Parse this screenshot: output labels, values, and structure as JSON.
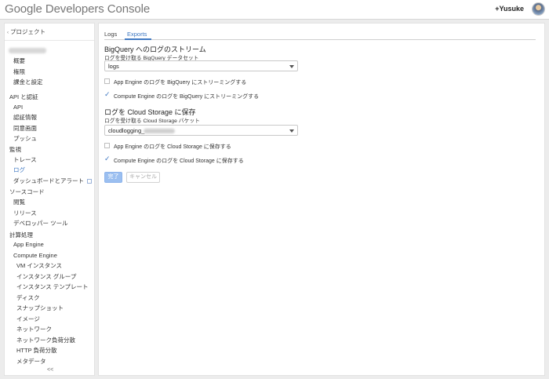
{
  "header": {
    "logo": "Google Developers Console",
    "user": "+Yusuke"
  },
  "sidebar": {
    "back_label": "プロジェクト",
    "project_items": [
      {
        "label": "概要"
      },
      {
        "label": "権限"
      },
      {
        "label": "課金と設定"
      }
    ],
    "sections": [
      {
        "title": "API と認証",
        "items": [
          "API",
          "認証情報",
          "同意画面",
          "プッシュ"
        ]
      },
      {
        "title": "監視",
        "items": [
          "トレース",
          "ログ",
          "ダッシュボードとアラート"
        ]
      },
      {
        "title": "ソースコード",
        "items": [
          "閲覧",
          "リリース",
          "デベロッパー ツール"
        ]
      },
      {
        "title": "計算処理",
        "items": [
          "App Engine",
          "Compute Engine"
        ]
      }
    ],
    "compute_subitems": [
      "VM インスタンス",
      "インスタンス グループ",
      "インスタンス テンプレート",
      "ディスク",
      "スナップショット",
      "イメージ",
      "ネットワーク",
      "ネットワーク負荷分散",
      "HTTP 負荷分散",
      "メタデータ"
    ],
    "active_item": "ログ",
    "collapse_label": "<<"
  },
  "tabs": [
    {
      "label": "Logs",
      "active": false
    },
    {
      "label": "Exports",
      "active": true
    }
  ],
  "bigquery": {
    "title": "BigQuery へのログのストリーム",
    "dataset_label": "ログを受け取る BigQuery データセット",
    "dataset_value": "logs",
    "checkboxes": [
      {
        "label": "App Engine のログを BigQuery にストリーミングする",
        "checked": false
      },
      {
        "label": "Compute Engine のログを BigQuery にストリーミングする",
        "checked": true
      }
    ]
  },
  "storage": {
    "title": "ログを Cloud Storage に保存",
    "bucket_label": "ログを受け取る Cloud Storage バケット",
    "bucket_value": "cloudlogging_",
    "checkboxes": [
      {
        "label": "App Engine のログを Cloud Storage に保存する",
        "checked": false
      },
      {
        "label": "Compute Engine のログを Cloud Storage に保存する",
        "checked": true
      }
    ]
  },
  "actions": {
    "done_label": "完了",
    "cancel_label": "キャンセル"
  },
  "colors": {
    "accent": "#3f78c2",
    "primary_button": "#9bbff0"
  }
}
